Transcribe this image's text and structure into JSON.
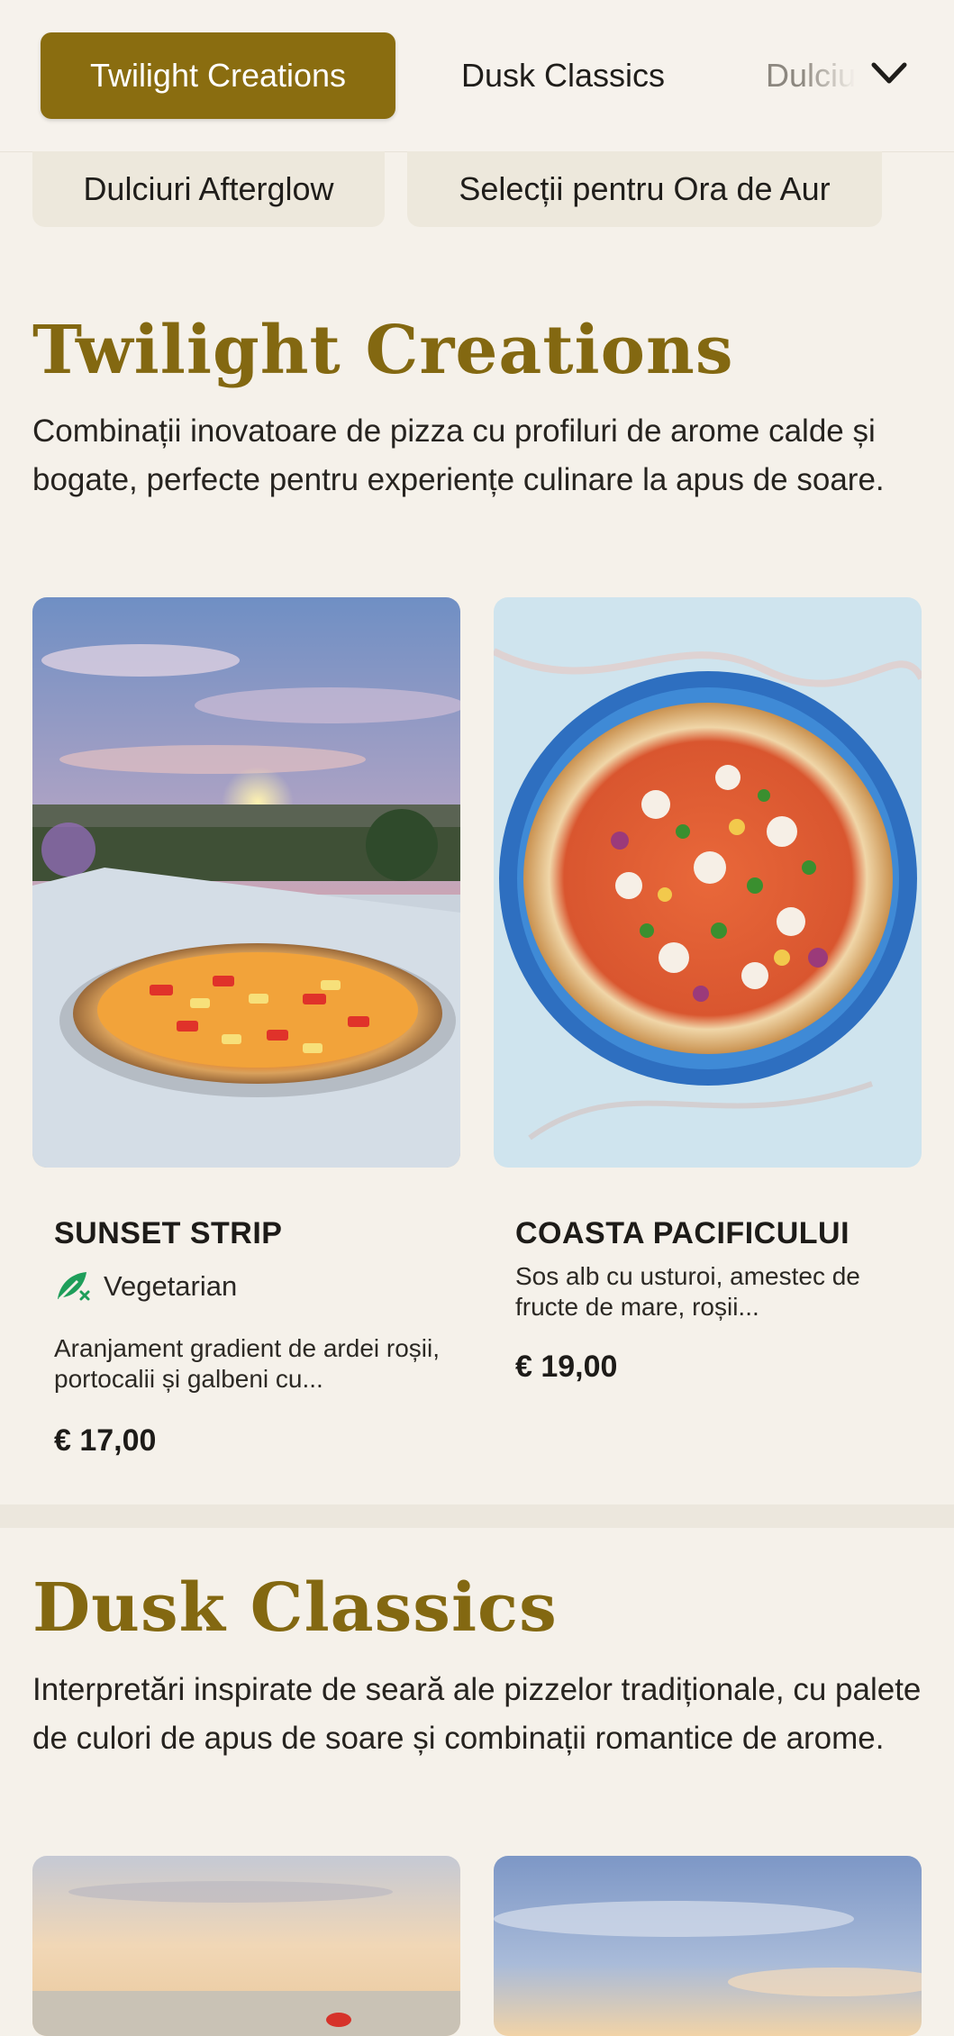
{
  "tabs": {
    "items": [
      "Twilight Creations",
      "Dusk Classics",
      "Dulciuri Afterglow"
    ],
    "active": "Twilight Creations",
    "more_icon": "chevron-down-icon"
  },
  "chips": [
    "Dulciuri Afterglow",
    "Selecții pentru Ora de Aur"
  ],
  "sections": [
    {
      "title": "Twilight Creations",
      "description": "Combinații inovatoare de pizza cu profiluri de arome calde și bogate, perfecte pentru experiențe culinare la apus de soare.",
      "items": [
        {
          "name": "SUNSET STRIP",
          "badge": "Vegetarian",
          "badge_icon": "leaf-icon",
          "description": "Aranjament gradient de ardei roșii, portocalii și galbeni cu...",
          "price": "€ 17,00"
        },
        {
          "name": "COASTA PACIFICULUI",
          "description": "Sos alb cu usturoi, amestec de fructe de mare, roșii...",
          "price": "€ 19,00"
        }
      ]
    },
    {
      "title": "Dusk Classics",
      "description": "Interpretări inspirate de seară ale pizzelor tradiționale, cu palete de culori de apus de soare și combinații romantice de arome."
    }
  ],
  "colors": {
    "accent": "#8a6d10",
    "background": "#f5f1ea",
    "veg_green": "#1e9e5a"
  }
}
